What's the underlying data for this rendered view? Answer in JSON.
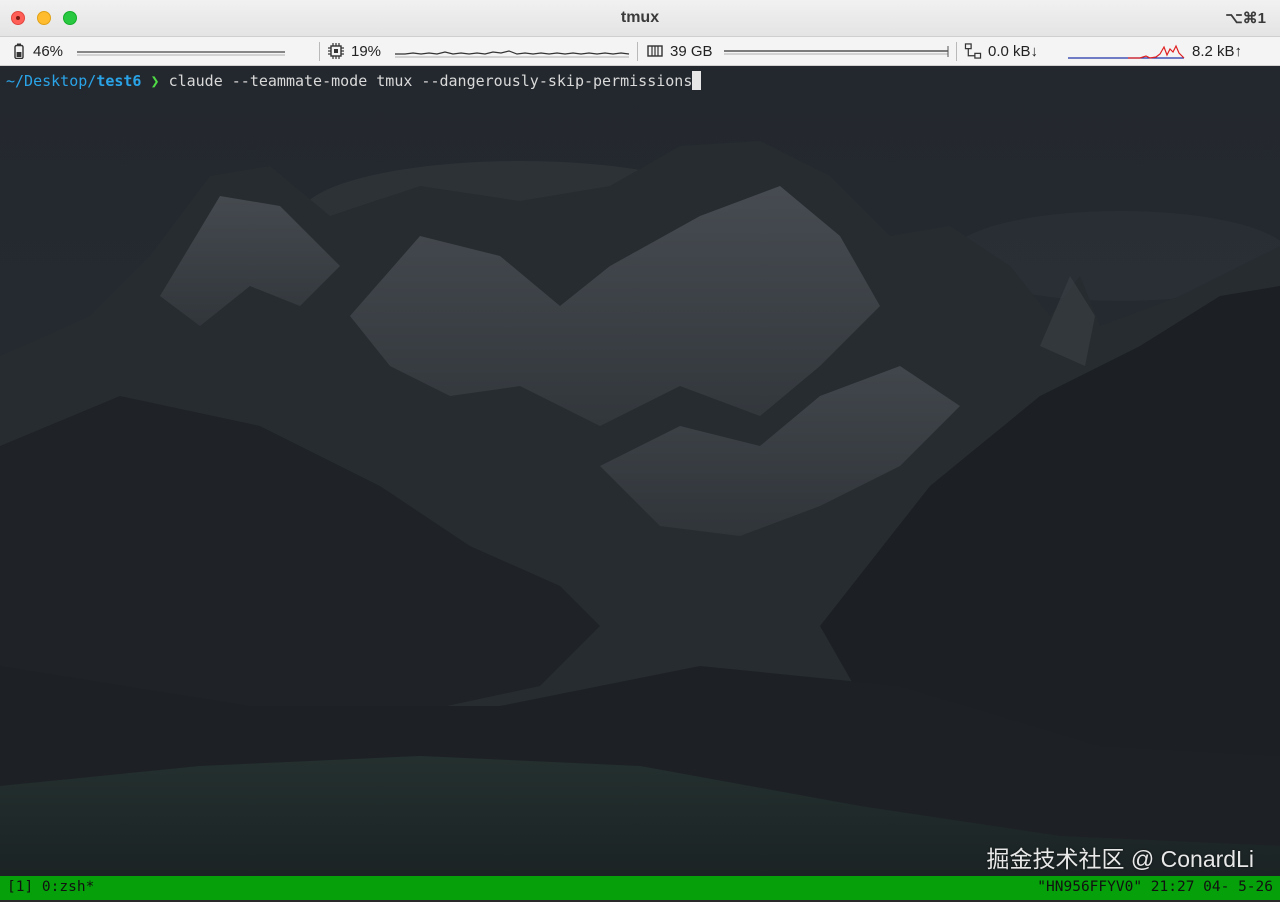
{
  "window": {
    "title": "tmux",
    "shortcut": "⌥⌘1"
  },
  "stats": {
    "battery": {
      "icon": "battery-icon",
      "label": "46%",
      "level": 0.46
    },
    "cpu": {
      "icon": "cpu-chip-icon",
      "label": "19%",
      "level": 0.19
    },
    "memory": {
      "icon": "memory-icon",
      "label": "39 GB"
    },
    "network": {
      "icon": "network-icon",
      "down_label": "0.0 kB↓",
      "up_label": "8.2 kB↑"
    }
  },
  "terminal": {
    "prompt_path": "~/Desktop/",
    "prompt_dir": "test6",
    "prompt_arrow": "❯",
    "command": "claude --teammate-mode tmux --dangerously-skip-permissions",
    "watermark": "掘金技术社区 @ ConardLi"
  },
  "tmux": {
    "left": "[1] 0:zsh*",
    "right": "\"HN956FFYV0\" 21:27 04- 5-26"
  },
  "colors": {
    "statusbar": "#06a10a",
    "prompt_path": "#2aa4e8",
    "prompt_arrow": "#4fdc45",
    "network_graph_down": "#2233aa",
    "network_graph_up": "#e02020"
  }
}
